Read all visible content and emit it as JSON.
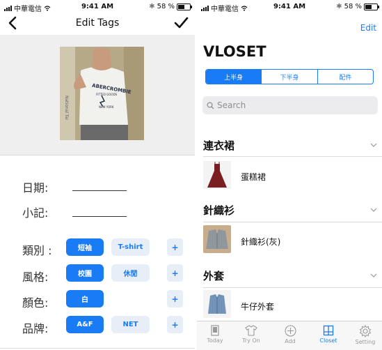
{
  "status": {
    "carrier": "中華電信",
    "time": "9:41 AM",
    "battery": "58 %",
    "battery_level": 0.58
  },
  "edit_tags": {
    "title": "Edit Tags",
    "fields": [
      {
        "label": "日期:"
      },
      {
        "label": "小記:"
      }
    ],
    "rows": [
      {
        "label": "類別 :",
        "tags": [
          "短袖",
          "T-shirt"
        ],
        "selected": 0
      },
      {
        "label": "風格:",
        "tags": [
          "校園",
          "休閒"
        ],
        "selected": 0
      },
      {
        "label": "顏色:",
        "tags": [
          "白"
        ],
        "selected": 0
      },
      {
        "label": "品牌:",
        "tags": [
          "A&F",
          "NET"
        ],
        "selected": 0
      }
    ],
    "add_symbol": "+",
    "photo_text": [
      "ABERCROMBIE",
      "FITTED GOODS",
      "NEW YORK",
      "National Tai"
    ]
  },
  "closet": {
    "edit_label": "Edit",
    "title": "VLOSET",
    "segments": [
      "上半身",
      "下半身",
      "配件"
    ],
    "active_segment": 0,
    "search_placeholder": "Search",
    "sections": [
      {
        "title": "連衣裙",
        "item": "蛋糕裙"
      },
      {
        "title": "針織衫",
        "item": "針織衫(灰)"
      },
      {
        "title": "外套",
        "item": "牛仔外套"
      }
    ],
    "tabs": [
      {
        "label": "Today",
        "icon": "today-icon"
      },
      {
        "label": "Try On",
        "icon": "shirt-icon"
      },
      {
        "label": "Add",
        "icon": "add-icon"
      },
      {
        "label": "Closet",
        "icon": "closet-icon"
      },
      {
        "label": "Setting",
        "icon": "gear-icon"
      }
    ],
    "active_tab": 3
  },
  "colors": {
    "accent": "#1a7cf5",
    "chip_bg": "#e8eef7",
    "photo_bg": "#efefef"
  }
}
